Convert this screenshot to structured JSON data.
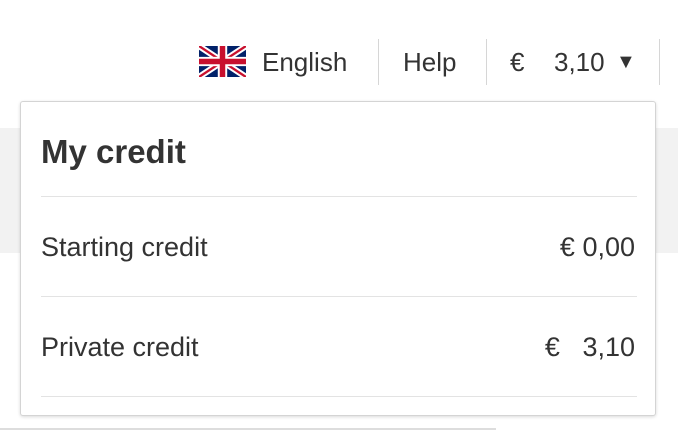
{
  "header": {
    "language": {
      "label": "English",
      "flag_icon": "uk-flag-icon"
    },
    "help_label": "Help",
    "credit": {
      "currency": "€",
      "amount": "3,10",
      "caret_icon": "caret-down-icon"
    }
  },
  "credit_panel": {
    "title": "My credit",
    "rows": [
      {
        "label": "Starting credit",
        "value": "€ 0,00"
      },
      {
        "label": "Private credit",
        "value": "€   3,10"
      }
    ]
  },
  "colors": {
    "text": "#333333",
    "background_band": "#f2f2f2",
    "divider": "#e3e3e3",
    "flag_blue": "#012169",
    "flag_red": "#C8102E"
  }
}
